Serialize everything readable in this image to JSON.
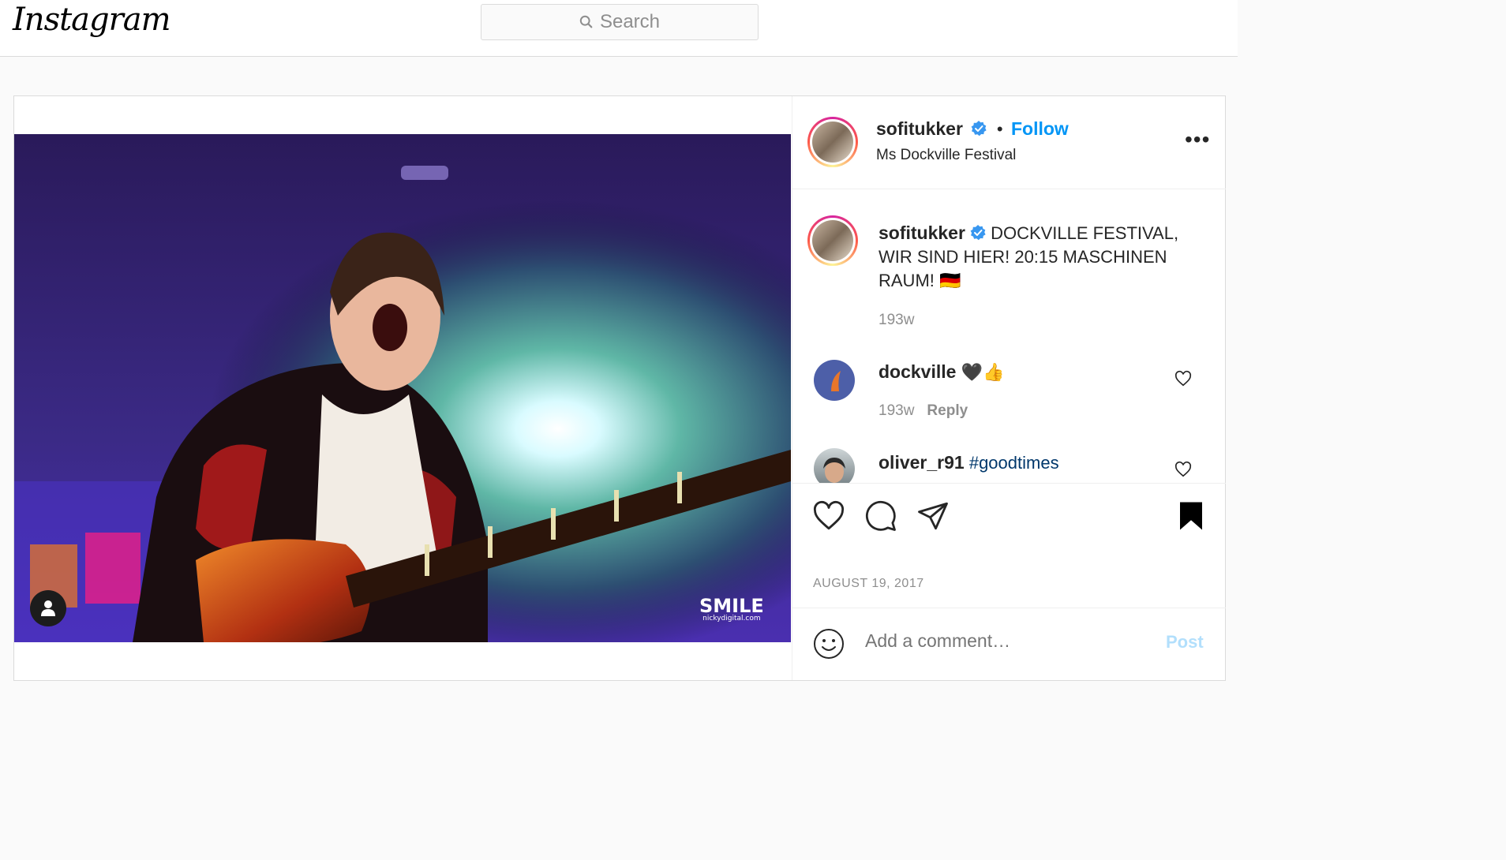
{
  "header": {
    "logo_text": "Instagram",
    "search_placeholder": "Search"
  },
  "post": {
    "watermark": {
      "brand": "SMILE",
      "site": "nickydigital.com"
    },
    "author": {
      "username": "sofitukker",
      "verified": true,
      "follow_label": "Follow",
      "location": "Ms Dockville Festival"
    },
    "caption": {
      "username": "sofitukker",
      "text": "DOCKVILLE FESTIVAL, WIR SIND HIER! 20:15 MASCHINEN RAUM! 🇩🇪",
      "time": "193w"
    },
    "comments": [
      {
        "username": "dockville",
        "text": "🖤👍",
        "time": "193w",
        "reply_label": "Reply"
      },
      {
        "username": "oliver_r91",
        "text": "#goodtimes"
      }
    ],
    "date": "AUGUST 19, 2017",
    "add_comment_placeholder": "Add a comment…",
    "post_label": "Post",
    "icons": [
      "like-icon",
      "comment-icon",
      "share-icon",
      "bookmark-icon",
      "emoji-icon",
      "more-icon",
      "search-icon",
      "user-tag-icon",
      "verified-badge-icon"
    ],
    "colors": {
      "follow": "#0095f6",
      "post_disabled": "#b2dffc",
      "hashtag": "#00376b",
      "muted": "#8e8e8e"
    }
  }
}
